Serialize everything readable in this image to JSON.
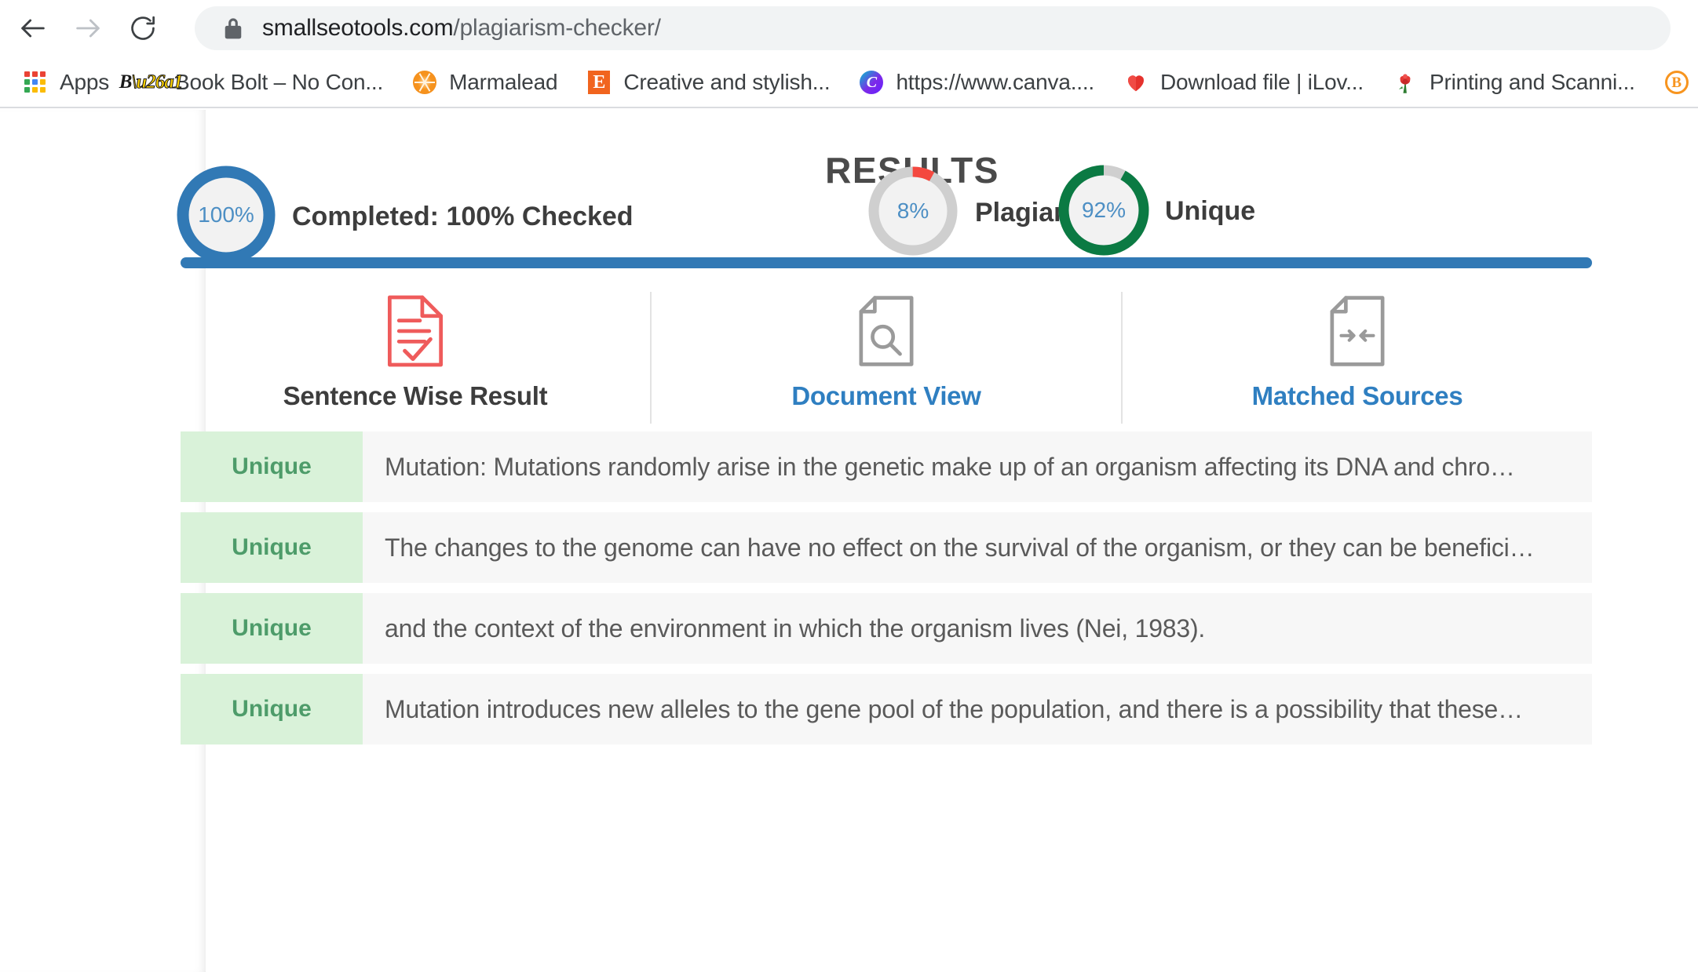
{
  "browser": {
    "back_icon": "back-arrow-icon",
    "forward_icon": "forward-arrow-icon",
    "reload_icon": "reload-icon",
    "lock_icon": "lock-icon",
    "url_host": "smallseotools.com",
    "url_path": "/plagiarism-checker/",
    "url_full": "smallseotools.com/plagiarism-checker/",
    "bookmarks": [
      {
        "label": "Apps",
        "icon": "apps-grid-icon"
      },
      {
        "label": "Book Bolt – No Con...",
        "icon": "book-bolt-icon"
      },
      {
        "label": "Marmalead",
        "icon": "marmalead-orange-icon"
      },
      {
        "label": "Creative and stylish...",
        "icon": "etsy-icon"
      },
      {
        "label": "https://www.canva....",
        "icon": "canva-icon"
      },
      {
        "label": "Download file | iLov...",
        "icon": "ilovepdf-heart-icon"
      },
      {
        "label": "Printing and Scanni...",
        "icon": "flower-icon"
      },
      {
        "label": "",
        "icon": "orange-b-circle-icon"
      }
    ]
  },
  "page": {
    "title": "RESULTS",
    "gauges": [
      {
        "name": "completed",
        "percent_text": "100%",
        "value": 100,
        "label": "Completed: 100% Checked",
        "arc_color": "#3179b5",
        "track_color": "#3179b5"
      },
      {
        "name": "plagiarism",
        "percent_text": "8%",
        "value": 8,
        "label": "Plagiarism",
        "arc_color": "#f4483f",
        "track_color": "#cfcfcf"
      },
      {
        "name": "unique",
        "percent_text": "92%",
        "value": 92,
        "label": "Unique",
        "arc_color": "#0b7a43",
        "track_color": "#cfcfcf"
      }
    ],
    "progress_bar": {
      "value": 100,
      "color": "#3179b5"
    },
    "tabs": [
      {
        "label": "Sentence Wise Result",
        "icon": "document-check-icon",
        "active": true
      },
      {
        "label": "Document View",
        "icon": "document-search-icon",
        "active": false
      },
      {
        "label": "Matched Sources",
        "icon": "document-arrows-icon",
        "active": false
      }
    ],
    "rows": [
      {
        "badge": "Unique",
        "text": "Mutation: Mutations randomly arise in the genetic make up of an organism affecting its DNA and chro…"
      },
      {
        "badge": "Unique",
        "text": "The changes to the genome can have no effect on the survival of the organism, or they can be benefici…"
      },
      {
        "badge": "Unique",
        "text": "and the context of the environment in which the organism lives (Nei, 1983)."
      },
      {
        "badge": "Unique",
        "text": "Mutation introduces new alleles to the gene pool of the population, and there is a possibility that these…"
      }
    ]
  }
}
